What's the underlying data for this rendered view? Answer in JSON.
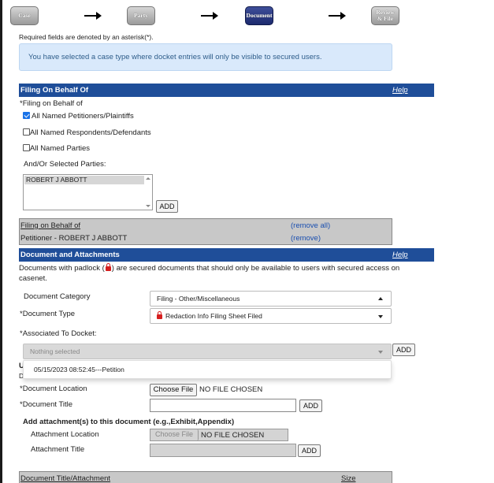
{
  "wizard": {
    "steps": [
      {
        "label": "Case",
        "state": "done"
      },
      {
        "label": "Party",
        "state": "done"
      },
      {
        "label": "Document",
        "state": "active"
      },
      {
        "label": "Review & File",
        "line1": "Review",
        "line2": "& File",
        "state": "pending"
      }
    ]
  },
  "required_note": "Required fields are denoted by an asterisk(*).",
  "info_banner": "You have selected a case type where docket entries will only be visible to secured users.",
  "filing_section": {
    "title": "Filing On Behalf Of",
    "help": "Help",
    "field_label": "Filing on Behalf of",
    "options": [
      {
        "label": "All Named Petitioners/Plaintiffs",
        "checked": true
      },
      {
        "label": "All Named Respondents/Defendants",
        "checked": false
      },
      {
        "label": "All Named Parties",
        "checked": false
      }
    ],
    "selected_parties_label": "And/Or Selected Parties:",
    "parties_list": [
      "ROBERT J ABBOTT"
    ],
    "add_button": "ADD",
    "grid": {
      "header": "Filing on Behalf of",
      "remove_all": "(remove all)",
      "rows": [
        {
          "party": "Petitioner - ROBERT J ABBOTT",
          "action": "(remove)"
        }
      ]
    }
  },
  "document_section": {
    "title": "Document and Attachments",
    "help": "Help",
    "padlock_note_1": "Documents with padlock (",
    "padlock_note_2": ") are secured documents that should only be available to users with secured access on",
    "padlock_note_3": "casenet.",
    "category_label": "Document Category",
    "category_value": "Filing - Other/Miscellaneous",
    "type_label": "Document Type",
    "type_value": "Redaction Info Filing Sheet Filed",
    "docket_label": "Associated To Docket:",
    "docket_placeholder": "Nothing selected",
    "docket_add": "ADD",
    "docket_options": [
      "05/15/2023 08:52:45---Petition"
    ],
    "hidden_heading_initial": "U",
    "hidden_line_initial": "D",
    "location_label": "Document Location",
    "choose_file": "Choose File",
    "no_file": "NO FILE CHOSEN",
    "title_label": "Document Title",
    "title_add": "ADD",
    "attach_heading": "Add attachment(s) to this document (e.g.,Exhibit,Appendix)",
    "attach_location_label": "Attachment Location",
    "attach_choose_file": "Choose File",
    "attach_no_file": "NO FILE CHOSEN",
    "attach_title_label": "Attachment Title",
    "attach_add": "ADD",
    "table_col_title": "Document Title/Attachment",
    "table_col_size": "Size"
  }
}
